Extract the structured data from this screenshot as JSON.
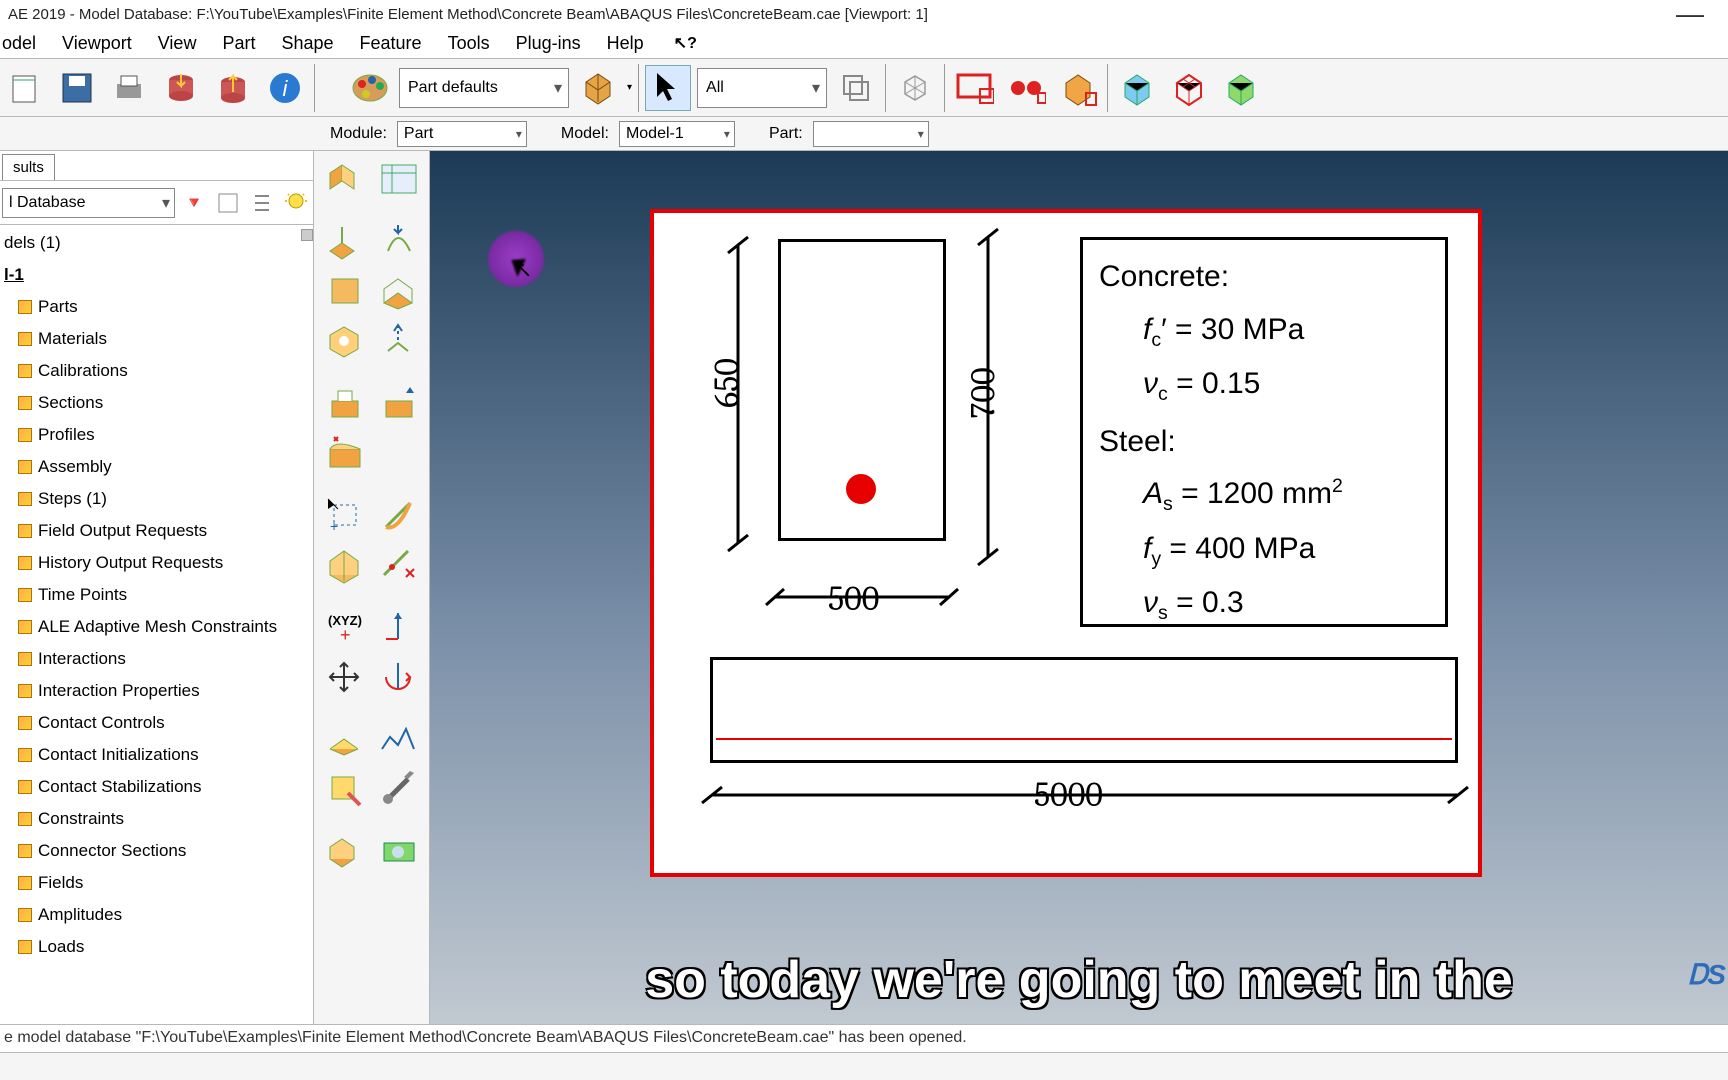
{
  "titlebar": {
    "text": "AE 2019 - Model Database: F:\\YouTube\\Examples\\Finite Element Method\\Concrete Beam\\ABAQUS Files\\ConcreteBeam.cae [Viewport: 1]",
    "minimize": "—"
  },
  "menu": [
    "odel",
    "Viewport",
    "View",
    "Part",
    "Shape",
    "Feature",
    "Tools",
    "Plug-ins",
    "Help"
  ],
  "help_pointer": "?",
  "part_defaults": "Part defaults",
  "visible_dd": "All",
  "context": {
    "module_lbl": "Module:",
    "module_val": "Part",
    "model_lbl": "Model:",
    "model_val": "Model-1",
    "part_lbl": "Part:",
    "part_val": ""
  },
  "sidebar": {
    "tab": "sults",
    "combo": "l Database",
    "root": "dels (1)",
    "model": "l-1",
    "items": [
      "Parts",
      "Materials",
      "Calibrations",
      "Sections",
      "Profiles",
      "Assembly",
      "Steps (1)",
      "Field Output Requests",
      "History Output Requests",
      "Time Points",
      "ALE Adaptive Mesh Constraints",
      "Interactions",
      "Interaction Properties",
      "Contact Controls",
      "Contact Initializations",
      "Contact Stabilizations",
      "Constraints",
      "Connector Sections",
      "Fields",
      "Amplitudes",
      "Loads"
    ]
  },
  "diagram": {
    "dim_650": "650",
    "dim_700": "700",
    "dim_500": "500",
    "dim_5000": "5000",
    "concrete_hdr": "Concrete:",
    "fc_eq": "𝑓꜀′ = 30 MPa",
    "vc_eq": "νc = 0.15",
    "steel_hdr": "Steel:",
    "as_eq": "𝐴ₛ = 1200 mm²",
    "fy_eq": "𝑓ᵧ = 400 MPa",
    "vs_eq": "νₛ = 0.3"
  },
  "subtitle": "so today we're going to meet in the",
  "status": "e model database \"F:\\YouTube\\Examples\\Finite Element Method\\Concrete Beam\\ABAQUS Files\\ConcreteBeam.cae\" has been opened."
}
